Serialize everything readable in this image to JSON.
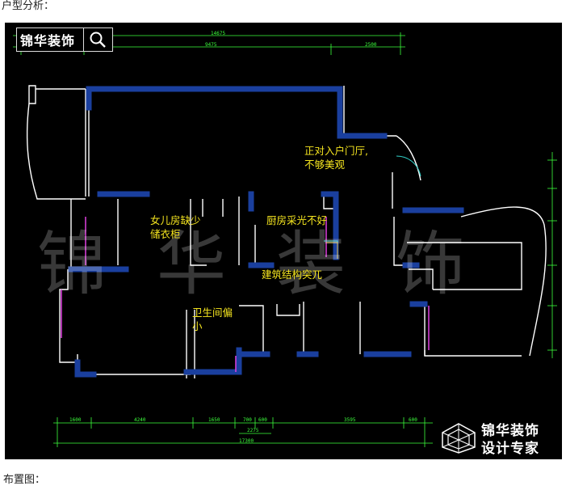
{
  "top_caption": "户型分析：",
  "bottom_caption": "布置图：",
  "brand": {
    "name": "锦华装饰"
  },
  "watermark": {
    "text": "锦华装饰"
  },
  "corner_logo": {
    "line1": "锦华装饰",
    "line2": "设计专家"
  },
  "annotations": {
    "entrance": "正对入户门厅,\n不够美观",
    "daughter_room": "女儿房缺少\n储衣柜",
    "kitchen": "厨房采光不好",
    "structure": "建筑结构突兀",
    "bathroom": "卫生间偏\n小"
  },
  "dimensions": {
    "top_overall": "14675",
    "top_left": "1600",
    "top_mid": "9475",
    "top_right": "2500",
    "bottom_overall": "17300",
    "bottom_sub": "2275",
    "bottom_segments": [
      "1600",
      "4240",
      "1650",
      "700",
      "600",
      "3595",
      "600"
    ]
  },
  "colors": {
    "background": "#000000",
    "wall_blue": "#1a3f9e",
    "wall_white": "#ffffff",
    "dimension_green": "#3cff3c",
    "annotation_yellow": "#f5e51f",
    "window_magenta": "#e040e0"
  }
}
